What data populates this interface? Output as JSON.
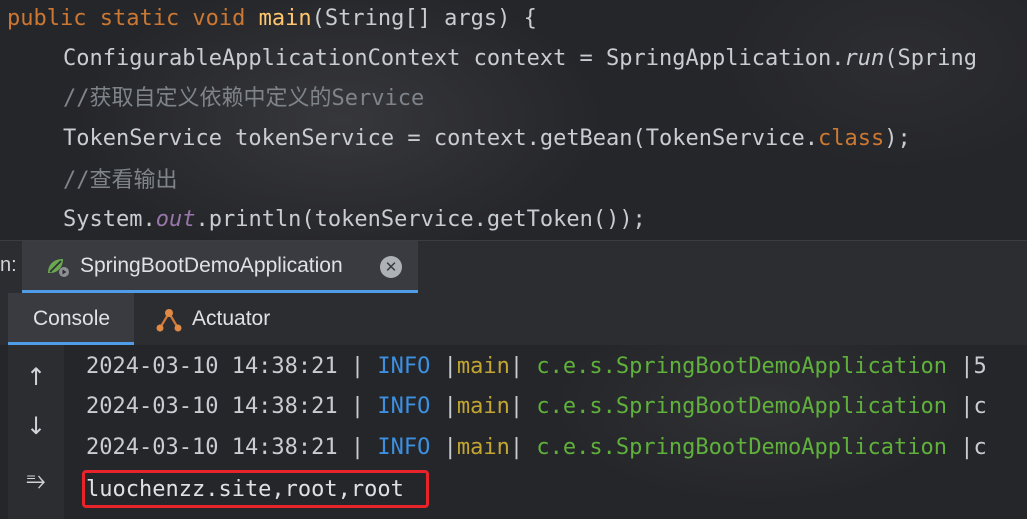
{
  "editor": {
    "lines": [
      {
        "kw1": "public static void ",
        "fn": "main",
        "rest": "(String[] args) {"
      },
      {
        "pre": "ConfigurableApplicationContext context = SpringApplication.",
        "it": "run",
        "post": "(Spring"
      },
      {
        "comment": "//获取自定义依赖中定义的Service"
      },
      {
        "pre": "TokenService tokenService = context.getBean(TokenService.",
        "kw": "class",
        "post": ");"
      },
      {
        "comment": "//查看输出"
      },
      {
        "pre": "System.",
        "fld": "out",
        "post": ".println(tokenService.getToken());"
      }
    ]
  },
  "run_bar": {
    "prefix": "n:",
    "tab_label": "SpringBootDemoApplication",
    "close_glyph": "✕",
    "tab_icon": "spring-run-icon"
  },
  "console_tabs": {
    "console_label": "Console",
    "actuator_label": "Actuator",
    "actuator_icon": "actuator-icon"
  },
  "gutter": {
    "up_icon": "↑",
    "down_icon": "↓",
    "wrap_icon": "⥱"
  },
  "log": {
    "entries": [
      {
        "timestamp": "2024-03-10 14:38:21",
        "sep1": " | ",
        "level": "INFO",
        "sep2": " |",
        "thread": "main",
        "sep3": "| ",
        "logger": "c.e.s.SpringBootDemoApplication",
        "sep4": " |",
        "tail": "5"
      },
      {
        "timestamp": "2024-03-10 14:38:21",
        "sep1": " | ",
        "level": "INFO",
        "sep2": " |",
        "thread": "main",
        "sep3": "| ",
        "logger": "c.e.s.SpringBootDemoApplication",
        "sep4": " |",
        "tail": "c"
      },
      {
        "timestamp": "2024-03-10 14:38:21",
        "sep1": " | ",
        "level": "INFO",
        "sep2": " |",
        "thread": "main",
        "sep3": "| ",
        "logger": "c.e.s.SpringBootDemoApplication",
        "sep4": " |",
        "tail": "c"
      }
    ],
    "output": "luochenzz.site,root,root"
  },
  "colors": {
    "keyword": "#cc7832",
    "method": "#ffc66d",
    "level": "#3d8fe0",
    "thread": "#c2a630",
    "logger": "#5fb13b",
    "highlight": "#e8232a",
    "active_tab_underline": "#4f9de8"
  }
}
